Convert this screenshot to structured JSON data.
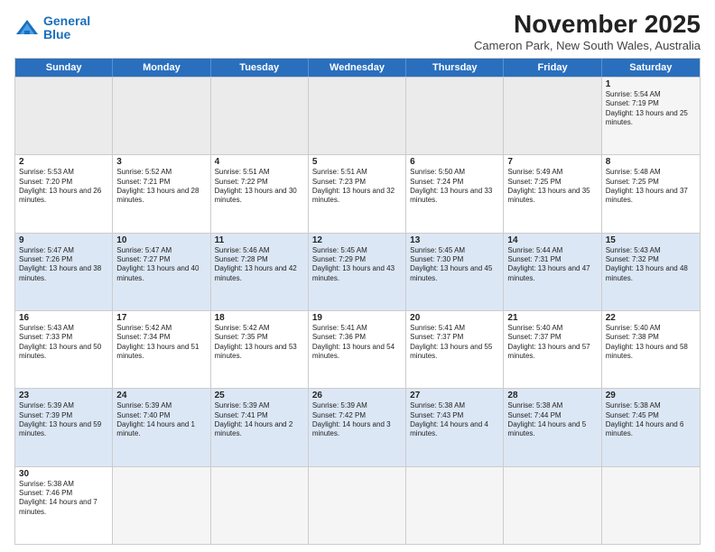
{
  "header": {
    "logo_general": "General",
    "logo_blue": "Blue",
    "month": "November 2025",
    "location": "Cameron Park, New South Wales, Australia"
  },
  "days": [
    "Sunday",
    "Monday",
    "Tuesday",
    "Wednesday",
    "Thursday",
    "Friday",
    "Saturday"
  ],
  "rows": [
    [
      {
        "day": "",
        "empty": true
      },
      {
        "day": "",
        "empty": true
      },
      {
        "day": "",
        "empty": true
      },
      {
        "day": "",
        "empty": true
      },
      {
        "day": "",
        "empty": true
      },
      {
        "day": "",
        "empty": true
      },
      {
        "day": "1",
        "sunrise": "5:54 AM",
        "sunset": "7:19 PM",
        "daylight": "13 hours and 25 minutes."
      }
    ],
    [
      {
        "day": "2",
        "sunrise": "5:53 AM",
        "sunset": "7:20 PM",
        "daylight": "13 hours and 26 minutes."
      },
      {
        "day": "3",
        "sunrise": "5:52 AM",
        "sunset": "7:21 PM",
        "daylight": "13 hours and 28 minutes."
      },
      {
        "day": "4",
        "sunrise": "5:51 AM",
        "sunset": "7:22 PM",
        "daylight": "13 hours and 30 minutes."
      },
      {
        "day": "5",
        "sunrise": "5:51 AM",
        "sunset": "7:23 PM",
        "daylight": "13 hours and 32 minutes."
      },
      {
        "day": "6",
        "sunrise": "5:50 AM",
        "sunset": "7:24 PM",
        "daylight": "13 hours and 33 minutes."
      },
      {
        "day": "7",
        "sunrise": "5:49 AM",
        "sunset": "7:25 PM",
        "daylight": "13 hours and 35 minutes."
      },
      {
        "day": "8",
        "sunrise": "5:48 AM",
        "sunset": "7:25 PM",
        "daylight": "13 hours and 37 minutes."
      }
    ],
    [
      {
        "day": "9",
        "sunrise": "5:47 AM",
        "sunset": "7:26 PM",
        "daylight": "13 hours and 38 minutes."
      },
      {
        "day": "10",
        "sunrise": "5:47 AM",
        "sunset": "7:27 PM",
        "daylight": "13 hours and 40 minutes."
      },
      {
        "day": "11",
        "sunrise": "5:46 AM",
        "sunset": "7:28 PM",
        "daylight": "13 hours and 42 minutes."
      },
      {
        "day": "12",
        "sunrise": "5:45 AM",
        "sunset": "7:29 PM",
        "daylight": "13 hours and 43 minutes."
      },
      {
        "day": "13",
        "sunrise": "5:45 AM",
        "sunset": "7:30 PM",
        "daylight": "13 hours and 45 minutes."
      },
      {
        "day": "14",
        "sunrise": "5:44 AM",
        "sunset": "7:31 PM",
        "daylight": "13 hours and 47 minutes."
      },
      {
        "day": "15",
        "sunrise": "5:43 AM",
        "sunset": "7:32 PM",
        "daylight": "13 hours and 48 minutes."
      }
    ],
    [
      {
        "day": "16",
        "sunrise": "5:43 AM",
        "sunset": "7:33 PM",
        "daylight": "13 hours and 50 minutes."
      },
      {
        "day": "17",
        "sunrise": "5:42 AM",
        "sunset": "7:34 PM",
        "daylight": "13 hours and 51 minutes."
      },
      {
        "day": "18",
        "sunrise": "5:42 AM",
        "sunset": "7:35 PM",
        "daylight": "13 hours and 53 minutes."
      },
      {
        "day": "19",
        "sunrise": "5:41 AM",
        "sunset": "7:36 PM",
        "daylight": "13 hours and 54 minutes."
      },
      {
        "day": "20",
        "sunrise": "5:41 AM",
        "sunset": "7:37 PM",
        "daylight": "13 hours and 55 minutes."
      },
      {
        "day": "21",
        "sunrise": "5:40 AM",
        "sunset": "7:37 PM",
        "daylight": "13 hours and 57 minutes."
      },
      {
        "day": "22",
        "sunrise": "5:40 AM",
        "sunset": "7:38 PM",
        "daylight": "13 hours and 58 minutes."
      }
    ],
    [
      {
        "day": "23",
        "sunrise": "5:39 AM",
        "sunset": "7:39 PM",
        "daylight": "13 hours and 59 minutes."
      },
      {
        "day": "24",
        "sunrise": "5:39 AM",
        "sunset": "7:40 PM",
        "daylight": "14 hours and 1 minute."
      },
      {
        "day": "25",
        "sunrise": "5:39 AM",
        "sunset": "7:41 PM",
        "daylight": "14 hours and 2 minutes."
      },
      {
        "day": "26",
        "sunrise": "5:39 AM",
        "sunset": "7:42 PM",
        "daylight": "14 hours and 3 minutes."
      },
      {
        "day": "27",
        "sunrise": "5:38 AM",
        "sunset": "7:43 PM",
        "daylight": "14 hours and 4 minutes."
      },
      {
        "day": "28",
        "sunrise": "5:38 AM",
        "sunset": "7:44 PM",
        "daylight": "14 hours and 5 minutes."
      },
      {
        "day": "29",
        "sunrise": "5:38 AM",
        "sunset": "7:45 PM",
        "daylight": "14 hours and 6 minutes."
      }
    ],
    [
      {
        "day": "30",
        "sunrise": "5:38 AM",
        "sunset": "7:46 PM",
        "daylight": "14 hours and 7 minutes."
      },
      {
        "day": "",
        "empty": true
      },
      {
        "day": "",
        "empty": true
      },
      {
        "day": "",
        "empty": true
      },
      {
        "day": "",
        "empty": true
      },
      {
        "day": "",
        "empty": true
      },
      {
        "day": "",
        "empty": true
      }
    ]
  ],
  "labels": {
    "sunrise": "Sunrise:",
    "sunset": "Sunset:",
    "daylight": "Daylight:"
  }
}
